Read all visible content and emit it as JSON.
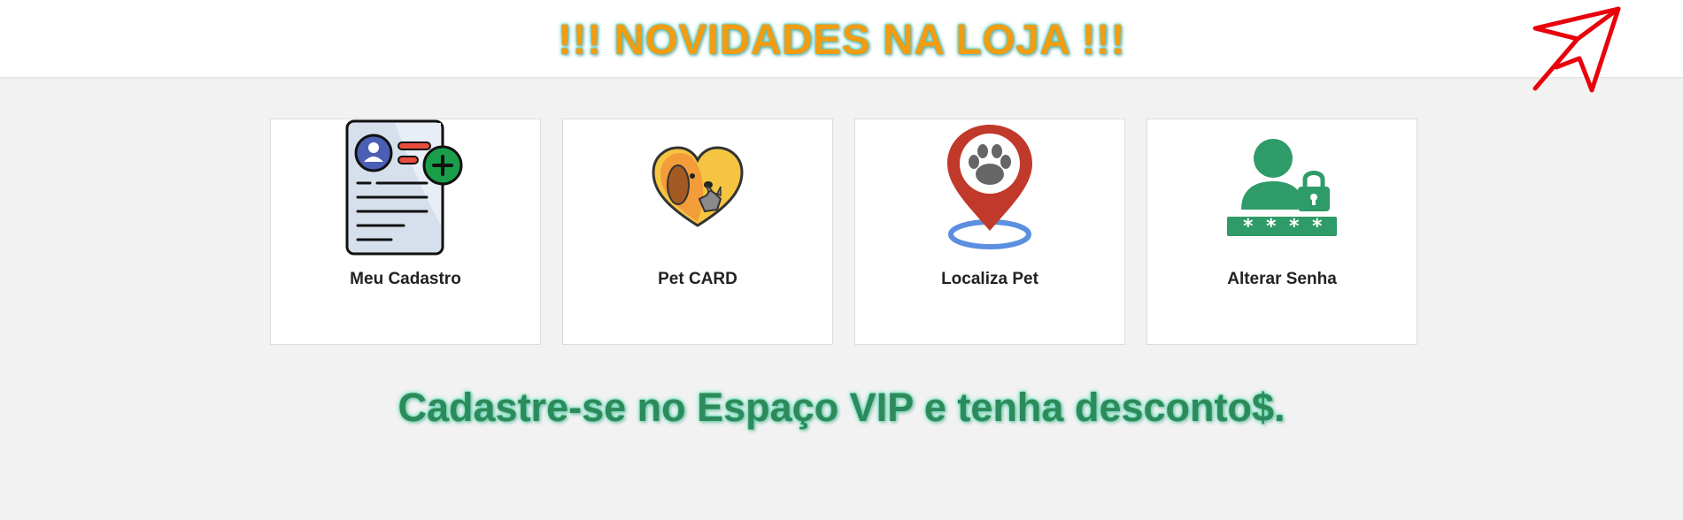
{
  "header": {
    "title": "!!! NOVIDADES NA LOJA !!!",
    "title_color": "#f39c12",
    "glow_color": "#35c7b8"
  },
  "cards": [
    {
      "label": "Meu Cadastro",
      "icon": "registration-form-icon"
    },
    {
      "label": "Pet CARD",
      "icon": "pet-heart-icon"
    },
    {
      "label": "Localiza Pet",
      "icon": "paw-location-pin-icon"
    },
    {
      "label": "Alterar Senha",
      "icon": "user-lock-password-icon"
    }
  ],
  "promo": {
    "text": "Cadastre-se no Espaço VIP e tenha desconto$.",
    "color": "#2e8a5a"
  },
  "annotation": {
    "icon": "red-arrow-cursor-icon",
    "color": "#e8000b"
  }
}
